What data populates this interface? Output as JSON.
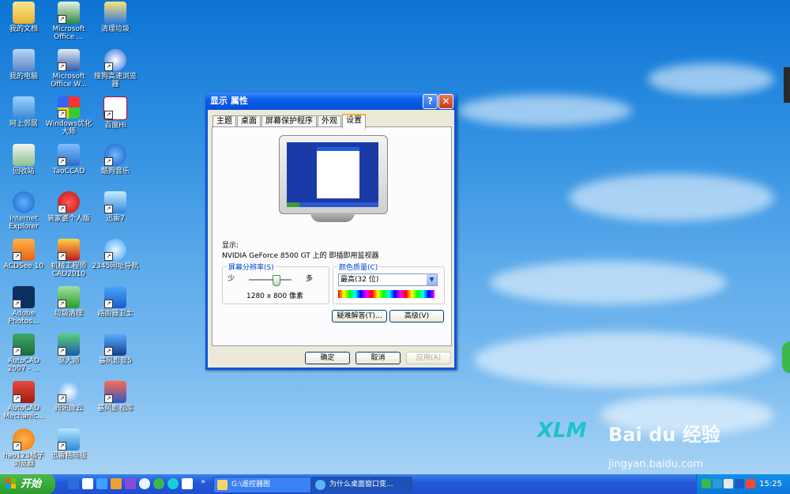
{
  "desktop": {
    "icons": [
      {
        "label": "我的文档"
      },
      {
        "label": "Microsoft Office ..."
      },
      {
        "label": "清理垃圾"
      },
      {
        "label": "我的电脑"
      },
      {
        "label": "Microsoft Office W..."
      },
      {
        "label": "搜狗高速浏览器"
      },
      {
        "label": "网上邻居"
      },
      {
        "label": "Windows优化大师"
      },
      {
        "label": "百度Hi"
      },
      {
        "label": "回收站"
      },
      {
        "label": "TaoCCAD"
      },
      {
        "label": "酷狗音乐"
      },
      {
        "label": "Internet Explorer"
      },
      {
        "label": "管家婆个人版"
      },
      {
        "label": "迅雷7"
      },
      {
        "label": "ACDSee 10"
      },
      {
        "label": "机械工程师CAD2010"
      },
      {
        "label": "2345网址导航"
      },
      {
        "label": "Adobe Photos..."
      },
      {
        "label": "垃圾清理"
      },
      {
        "label": "路由器卫士"
      },
      {
        "label": "AutoCAD 2007 - ..."
      },
      {
        "label": "驱大师"
      },
      {
        "label": "暴风影音5"
      },
      {
        "label": "AutoCAD Mechanic..."
      },
      {
        "label": "腾讯微云"
      },
      {
        "label": "暴风影视库"
      },
      {
        "label": "hao123橘子浏览器"
      },
      {
        "label": "迅雷精简版"
      }
    ]
  },
  "dialog": {
    "title": "显示 属性",
    "help_glyph": "?",
    "close_glyph": "✕",
    "tabs": [
      "主题",
      "桌面",
      "屏幕保护程序",
      "外观",
      "设置"
    ],
    "active_tab": "设置",
    "display_label": "显示:",
    "display_device": "NVIDIA GeForce 8500 GT 上的 即插即用监视器",
    "resolution": {
      "group_label": "屏幕分辨率(S)",
      "less": "少",
      "more": "多",
      "value": "1280 x 800 像素"
    },
    "color_quality": {
      "group_label": "颜色质量(C)",
      "selected": "最高(32 位)"
    },
    "troubleshoot_button": "疑难解答(T)...",
    "advanced_button": "高级(V)",
    "ok_button": "确定",
    "cancel_button": "取消",
    "apply_button": "应用(A)"
  },
  "taskbar": {
    "start_label": "开始",
    "tasks": [
      {
        "label": "G:\\遥控器图",
        "active": false
      },
      {
        "label": "为什么桌面窗口变...",
        "active": true
      }
    ],
    "clock": "15:25"
  },
  "watermark": {
    "brand": "Bai du 经验",
    "url": "jingyan.baidu.com"
  },
  "colors": {
    "xp_blue": "#0a56e0",
    "dialog_face": "#ece9d8",
    "start_green": "#3a9b3a"
  }
}
